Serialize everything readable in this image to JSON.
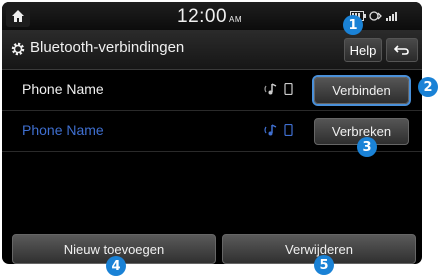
{
  "statusbar": {
    "time": "12:00",
    "ampm": "AM"
  },
  "titlebar": {
    "title": "Bluetooth-verbindingen",
    "help_label": "Help"
  },
  "devices": [
    {
      "name": "Phone Name",
      "action_label": "Verbinden"
    },
    {
      "name": "Phone Name",
      "action_label": "Verbreken"
    }
  ],
  "bottom": {
    "add_label": "Nieuw toevoegen",
    "delete_label": "Verwijderen"
  },
  "callouts": [
    "1",
    "2",
    "3",
    "4",
    "5"
  ],
  "colors": {
    "accent_blue": "#1a82d6",
    "connected_text": "#3f6fd0",
    "focus_outline": "#4a90d9"
  },
  "icons": [
    "home-icon",
    "gear-icon",
    "back-icon",
    "bluetooth-audio-icon",
    "phone-icon",
    "battery-icon",
    "signal-icon"
  ]
}
